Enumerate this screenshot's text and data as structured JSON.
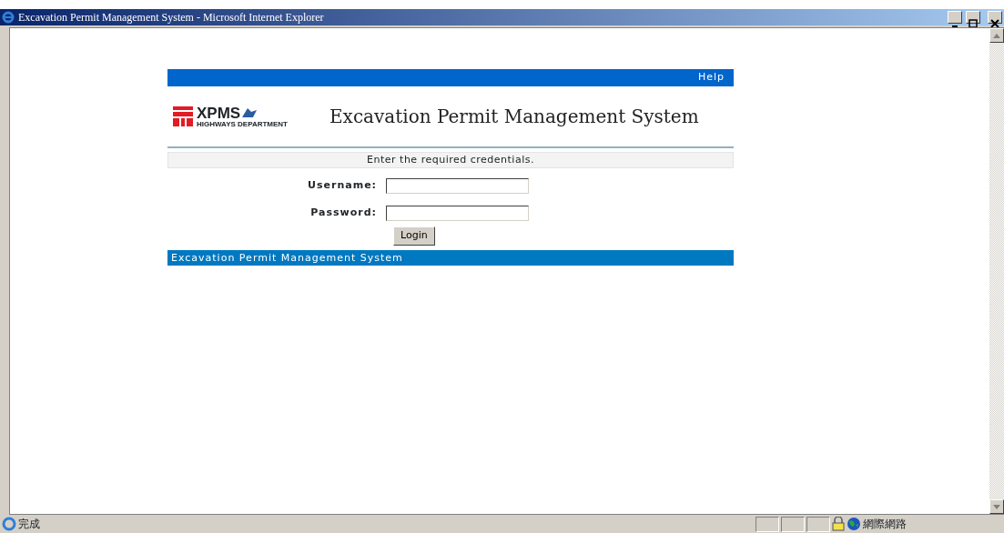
{
  "window": {
    "title": "Excavation Permit Management System - Microsoft Internet Explorer"
  },
  "top_bar": {
    "help_link": "Help"
  },
  "logo": {
    "mark": "XPMS",
    "subtitle": "HIGHWAYS DEPARTMENT"
  },
  "page_title": "Excavation Permit Management System",
  "message": "Enter the required credentials.",
  "form": {
    "fields": [
      {
        "label": "Username:"
      },
      {
        "label": "Password:"
      }
    ],
    "submit": "Login"
  },
  "footer": "Excavation Permit Management System",
  "status_bar": {
    "status": "完成",
    "zone": "網際網路"
  }
}
